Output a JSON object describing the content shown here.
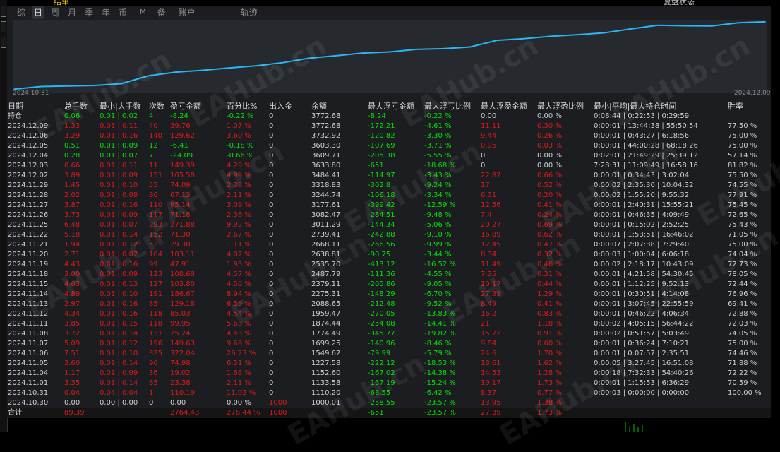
{
  "top_strip": {
    "left_text": "结单",
    "right_text": "复盘状态"
  },
  "tabs": [
    "综",
    "日",
    "周",
    "月",
    "季",
    "年",
    "币",
    "M",
    "备",
    "账户",
    "轨迹"
  ],
  "active_tab": "日",
  "chart_data": {
    "type": "line",
    "x_start_label": "2024.10.31",
    "x_end_label": "2024.12.09",
    "series_color": "#29b6f6",
    "ylim": [
      950,
      3800
    ],
    "x": [
      "2024.10.30",
      "2024.10.31",
      "2024.11.01",
      "2024.11.04",
      "2024.11.05",
      "2024.11.06",
      "2024.11.07",
      "2024.11.08",
      "2024.11.11",
      "2024.11.12",
      "2024.11.13",
      "2024.11.14",
      "2024.11.15",
      "2024.11.18",
      "2024.11.19",
      "2024.11.20",
      "2024.11.21",
      "2024.11.22",
      "2024.11.25",
      "2024.11.26",
      "2024.11.27",
      "2024.11.28",
      "2024.11.29",
      "2024.12.02",
      "2024.12.03",
      "2024.12.04",
      "2024.12.05",
      "2024.12.06",
      "2024.12.09"
    ],
    "values": [
      1000.01,
      1110.2,
      1133.58,
      1152.6,
      1227.58,
      1549.62,
      1699.25,
      1774.49,
      1874.44,
      1959.47,
      2088.65,
      2275.31,
      2379.11,
      2487.79,
      2535.7,
      2638.81,
      2668.11,
      2739.41,
      3011.29,
      3082.47,
      3177.61,
      3244.74,
      3318.83,
      3484.41,
      3633.8,
      3609.71,
      3603.3,
      3732.92,
      3772.68
    ]
  },
  "colors": {
    "positive": "#00e000",
    "negative": "#e01818",
    "neutral": "#d0d0d0",
    "line": "#29b6f6"
  },
  "headers": [
    "日期",
    "总手数",
    "最小|大手数",
    "次数",
    "盈亏金额",
    "百分比%",
    "出入金",
    "余额",
    "最大浮亏金额",
    "最大浮亏比例",
    "最大浮盈金额",
    "最大浮盈比例",
    "最小|平均|最大持仓时间",
    "胜率"
  ],
  "rows": [
    {
      "c": [
        "持仓",
        "0.06",
        "0.01 | 0.02",
        "4",
        "-8.24",
        "-0.22 %",
        "0",
        "3772.68",
        "-8.24",
        "-0.22 %",
        "0.00",
        "0.00 %",
        "0:08:44 | 0:22:53 | 0:29:59",
        ""
      ],
      "k": [
        "w",
        "g",
        "g",
        "g",
        "g",
        "g",
        "w",
        "w",
        "g",
        "g",
        "w",
        "w",
        "w",
        "w"
      ]
    },
    {
      "c": [
        "2024.12.09",
        "1.33",
        "0.01 | 0.11",
        "40",
        "39.76",
        "1.07 %",
        "0",
        "3772.68",
        "-172.21",
        "-4.61 %",
        "11.11",
        "0.30 %",
        "0:00:01 | 13:44:38 | 55:50:54",
        "77.50 %"
      ],
      "k": [
        "w",
        "r",
        "r",
        "r",
        "r",
        "r",
        "w",
        "w",
        "g",
        "g",
        "r",
        "r",
        "w",
        "w"
      ]
    },
    {
      "c": [
        "2024.12.06",
        "3.29",
        "0.01 | 0.16",
        "140",
        "129.62",
        "3.60 %",
        "0",
        "3732.92",
        "-120.82",
        "-3.30 %",
        "9.44",
        "0.26 %",
        "0:00:01 | 0:43:27 | 6:18:56",
        "75.00 %"
      ],
      "k": [
        "w",
        "r",
        "r",
        "r",
        "r",
        "r",
        "w",
        "w",
        "g",
        "g",
        "r",
        "r",
        "w",
        "w"
      ]
    },
    {
      "c": [
        "2024.12.05",
        "0.51",
        "0.01 | 0.09",
        "12",
        "-6.41",
        "-0.18 %",
        "0",
        "3603.30",
        "-107.69",
        "-3.71 %",
        "0.96",
        "0.03 %",
        "0:00:01 | 44:00:28 | 68:18:26",
        "75.00 %"
      ],
      "k": [
        "w",
        "g",
        "g",
        "g",
        "g",
        "g",
        "w",
        "w",
        "g",
        "g",
        "r",
        "r",
        "w",
        "w"
      ]
    },
    {
      "c": [
        "2024.12.04",
        "0.28",
        "0.01 | 0.07",
        "7",
        "-24.09",
        "-0.66 %",
        "0",
        "3609.71",
        "-205.38",
        "-5.55 %",
        "0",
        "0.00 %",
        "0:02:01 | 21:49:29 | 25:39:12",
        "57.14 %"
      ],
      "k": [
        "w",
        "g",
        "g",
        "g",
        "g",
        "g",
        "w",
        "w",
        "g",
        "g",
        "w",
        "w",
        "w",
        "w"
      ]
    },
    {
      "c": [
        "2024.12.03",
        "0.66",
        "0.01 | 0.11",
        "11",
        "149.39",
        "4.29 %",
        "0",
        "3633.80",
        "-651",
        "-18.68 %",
        "0",
        "0.00 %",
        "7:28:31 | 11:09:49 | 16:58:16",
        "81.82 %"
      ],
      "k": [
        "w",
        "r",
        "r",
        "r",
        "r",
        "r",
        "w",
        "w",
        "g",
        "g",
        "w",
        "w",
        "w",
        "w"
      ]
    },
    {
      "c": [
        "2024.12.02",
        "3.89",
        "0.01 | 0.09",
        "151",
        "165.58",
        "4.99 %",
        "0",
        "3484.41",
        "-114.97",
        "-3.43 %",
        "22.87",
        "0.66 %",
        "0:00:01 | 0:34:43 | 3:02:04",
        "75.50 %"
      ],
      "k": [
        "w",
        "r",
        "r",
        "r",
        "r",
        "r",
        "w",
        "w",
        "g",
        "g",
        "r",
        "r",
        "w",
        "w"
      ]
    },
    {
      "c": [
        "2024.11.29",
        "1.45",
        "0.01 | 0.10",
        "55",
        "74.09",
        "2.28 %",
        "0",
        "3318.83",
        "-302.8",
        "-9.24 %",
        "17",
        "0.52 %",
        "0:00:02 | 2:35:30 | 10:04:32",
        "74.55 %"
      ],
      "k": [
        "w",
        "r",
        "r",
        "r",
        "r",
        "r",
        "w",
        "w",
        "g",
        "g",
        "r",
        "r",
        "w",
        "w"
      ]
    },
    {
      "c": [
        "2024.11.28",
        "2.02",
        "0.01 | 0.08",
        "86",
        "67.13",
        "2.11 %",
        "0",
        "3244.74",
        "-106.18",
        "-3.34 %",
        "6.31",
        "0.20 %",
        "0:00:02 | 1:55:20 | 9:55:32",
        "77.91 %"
      ],
      "k": [
        "w",
        "r",
        "r",
        "r",
        "r",
        "r",
        "w",
        "w",
        "g",
        "g",
        "r",
        "r",
        "w",
        "w"
      ]
    },
    {
      "c": [
        "2024.11.27",
        "3.87",
        "0.01 | 0.16",
        "110",
        "95.14",
        "3.09 %",
        "0",
        "3177.61",
        "-399.42",
        "-12.59 %",
        "12.56",
        "0.41 %",
        "0:00:01 | 2:40:31 | 15:55:21",
        "75.45 %"
      ],
      "k": [
        "w",
        "r",
        "r",
        "r",
        "r",
        "r",
        "w",
        "w",
        "g",
        "g",
        "r",
        "r",
        "w",
        "w"
      ]
    },
    {
      "c": [
        "2024.11.26",
        "3.73",
        "0.01 | 0.09",
        "117",
        "71.18",
        "2.36 %",
        "0",
        "3082.47",
        "-284.51",
        "-9.48 %",
        "7.4",
        "0.24 %",
        "0:00:01 | 0:46:35 | 4:09:49",
        "72.65 %"
      ],
      "k": [
        "w",
        "r",
        "r",
        "r",
        "r",
        "r",
        "w",
        "w",
        "g",
        "g",
        "r",
        "r",
        "w",
        "w"
      ]
    },
    {
      "c": [
        "2024.11.25",
        "6.48",
        "0.01 | 0.07",
        "293",
        "271.88",
        "9.92 %",
        "0",
        "3011.29",
        "-144.34",
        "-5.06 %",
        "20.27",
        "0.69 %",
        "0:00:01 | 0:15:02 | 2:52:25",
        "75.43 %"
      ],
      "k": [
        "w",
        "r",
        "r",
        "r",
        "r",
        "r",
        "w",
        "w",
        "g",
        "g",
        "r",
        "r",
        "w",
        "w"
      ]
    },
    {
      "c": [
        "2024.11.22",
        "5.18",
        "0.01 | 0.14",
        "152",
        "71.30",
        "2.67 %",
        "0",
        "2739.41",
        "-242.88",
        "-9.10 %",
        "16.89",
        "0.62 %",
        "0:00:01 | 1:53:51 | 16:46:02",
        "71.05 %"
      ],
      "k": [
        "w",
        "r",
        "r",
        "r",
        "r",
        "r",
        "w",
        "w",
        "g",
        "g",
        "r",
        "r",
        "w",
        "w"
      ]
    },
    {
      "c": [
        "2024.11.21",
        "1.94",
        "0.01 | 0.12",
        "52",
        "29.30",
        "1.11 %",
        "0",
        "2668.11",
        "-266.56",
        "-9.99 %",
        "12.45",
        "0.47 %",
        "0:00:07 | 2:07:38 | 7:29:40",
        "75.00 %"
      ],
      "k": [
        "w",
        "r",
        "r",
        "r",
        "r",
        "r",
        "w",
        "w",
        "g",
        "g",
        "r",
        "r",
        "w",
        "w"
      ]
    },
    {
      "c": [
        "2024.11.20",
        "2.71",
        "0.01 | 0.07",
        "104",
        "103.11",
        "4.07 %",
        "0",
        "2638.81",
        "-90.75",
        "-3.44 %",
        "8.34",
        "0.32 %",
        "0:00:03 | 1:00:04 | 6:06:18",
        "74.04 %"
      ],
      "k": [
        "w",
        "r",
        "r",
        "r",
        "r",
        "r",
        "w",
        "w",
        "g",
        "g",
        "r",
        "r",
        "w",
        "w"
      ]
    },
    {
      "c": [
        "2024.11.19",
        "4.43",
        "0.01 | 0.16",
        "99",
        "47.91",
        "1.93 %",
        "0",
        "2535.70",
        "-413.12",
        "-16.52 %",
        "11.49",
        "0.46 %",
        "0:00:02 | 2:18:17 | 10:43:09",
        "72.73 %"
      ],
      "k": [
        "w",
        "r",
        "r",
        "r",
        "r",
        "r",
        "w",
        "w",
        "g",
        "g",
        "r",
        "r",
        "w",
        "w"
      ]
    },
    {
      "c": [
        "2024.11.18",
        "3.00",
        "0.01 | 0.09",
        "123",
        "108.68",
        "4.57 %",
        "0",
        "2487.79",
        "-111.36",
        "-4.55 %",
        "7.35",
        "0.31 %",
        "0:00:01 | 4:21:58 | 54:30:45",
        "78.05 %"
      ],
      "k": [
        "w",
        "r",
        "r",
        "r",
        "r",
        "r",
        "w",
        "w",
        "g",
        "g",
        "r",
        "r",
        "w",
        "w"
      ]
    },
    {
      "c": [
        "2024.11.15",
        "4.03",
        "0.01 | 0.13",
        "127",
        "103.80",
        "4.56 %",
        "0",
        "2379.11",
        "-205.86",
        "-9.05 %",
        "10.17",
        "0.44 %",
        "0:00:01 | 1:12:25 | 9:52:13",
        "72.44 %"
      ],
      "k": [
        "w",
        "r",
        "r",
        "r",
        "r",
        "r",
        "w",
        "w",
        "g",
        "g",
        "r",
        "r",
        "w",
        "w"
      ]
    },
    {
      "c": [
        "2024.11.14",
        "4.89",
        "0.01 | 0.10",
        "191",
        "186.67",
        "8.94 %",
        "0",
        "2275.31",
        "-148.29",
        "-6.70 %",
        "27.39",
        "1.29 %",
        "0:00:01 | 0:30:51 | 4:14:08",
        "76.96 %"
      ],
      "k": [
        "w",
        "r",
        "r",
        "r",
        "r",
        "r",
        "w",
        "w",
        "g",
        "g",
        "r",
        "r",
        "w",
        "w"
      ]
    },
    {
      "c": [
        "2024.11.13",
        "2.97",
        "0.01 | 0.16",
        "85",
        "129.18",
        "6.59 %",
        "0",
        "2088.65",
        "-212.48",
        "-9.52 %",
        "8.49",
        "0.41 %",
        "0:00:01 | 3:07:45 | 22:55:59",
        "69.41 %"
      ],
      "k": [
        "w",
        "r",
        "r",
        "r",
        "r",
        "r",
        "w",
        "w",
        "g",
        "g",
        "r",
        "r",
        "w",
        "w"
      ]
    },
    {
      "c": [
        "2024.11.12",
        "4.34",
        "0.01 | 0.16",
        "118",
        "85.03",
        "4.54 %",
        "0",
        "1959.47",
        "-270.05",
        "-13.83 %",
        "16.2",
        "0.83 %",
        "0:00:01 | 0:46:22 | 4:06:34",
        "72.88 %"
      ],
      "k": [
        "w",
        "r",
        "r",
        "r",
        "r",
        "r",
        "w",
        "w",
        "g",
        "g",
        "r",
        "r",
        "w",
        "w"
      ]
    },
    {
      "c": [
        "2024.11.11",
        "3.85",
        "0.01 | 0.15",
        "118",
        "99.95",
        "5.63 %",
        "0",
        "1874.44",
        "-254.08",
        "-14.41 %",
        "21",
        "1.18 %",
        "0:00:02 | 4:05:15 | 56:44:22",
        "72.03 %"
      ],
      "k": [
        "w",
        "r",
        "r",
        "r",
        "r",
        "r",
        "w",
        "w",
        "g",
        "g",
        "r",
        "r",
        "w",
        "w"
      ]
    },
    {
      "c": [
        "2024.11.08",
        "3.72",
        "0.01 | 0.14",
        "131",
        "75.24",
        "4.43 %",
        "0",
        "1774.49",
        "-345.77",
        "-19.82 %",
        "15.72",
        "0.91 %",
        "0:00:02 | 0:51:57 | 5:03:49",
        "74.05 %"
      ],
      "k": [
        "w",
        "r",
        "r",
        "r",
        "r",
        "r",
        "w",
        "w",
        "g",
        "g",
        "r",
        "r",
        "w",
        "w"
      ]
    },
    {
      "c": [
        "2024.11.07",
        "5.09",
        "0.01 | 0.12",
        "196",
        "149.63",
        "9.66 %",
        "0",
        "1699.25",
        "-140.96",
        "-8.46 %",
        "9.84",
        "0.60 %",
        "0:00:01 | 0:36:24 | 7:10:21",
        "75.00 %"
      ],
      "k": [
        "w",
        "r",
        "r",
        "r",
        "r",
        "r",
        "w",
        "w",
        "g",
        "g",
        "r",
        "r",
        "w",
        "w"
      ]
    },
    {
      "c": [
        "2024.11.06",
        "7.51",
        "0.01 | 0.10",
        "325",
        "322.04",
        "26.23 %",
        "0",
        "1549.62",
        "-79.99",
        "-5.79 %",
        "24.6",
        "1.70 %",
        "0:00:01 | 0:07:57 | 2:35:51",
        "74.46 %"
      ],
      "k": [
        "w",
        "r",
        "r",
        "r",
        "r",
        "r",
        "w",
        "w",
        "g",
        "g",
        "r",
        "r",
        "w",
        "w"
      ]
    },
    {
      "c": [
        "2024.11.05",
        "3.60",
        "0.01 | 0.14",
        "96",
        "74.98",
        "6.51 %",
        "0",
        "1227.58",
        "-222.12",
        "-18.53 %",
        "18.61",
        "1.62 %",
        "0:00:05 | 3:27:45 | 16:51:08",
        "71.88 %"
      ],
      "k": [
        "w",
        "r",
        "r",
        "r",
        "r",
        "r",
        "w",
        "w",
        "g",
        "g",
        "r",
        "r",
        "w",
        "w"
      ]
    },
    {
      "c": [
        "2024.11.04",
        "1.17",
        "0.01 | 0.09",
        "36",
        "19.02",
        "1.68 %",
        "0",
        "1152.60",
        "-167.02",
        "-14.38 %",
        "14.53",
        "1.28 %",
        "0:00:18 | 7:32:33 | 54:40:26",
        "72.22 %"
      ],
      "k": [
        "w",
        "r",
        "r",
        "r",
        "r",
        "r",
        "w",
        "w",
        "g",
        "g",
        "r",
        "r",
        "w",
        "w"
      ]
    },
    {
      "c": [
        "2024.11.01",
        "3.35",
        "0.01 | 0.14",
        "85",
        "23.38",
        "2.11 %",
        "0",
        "1133.58",
        "-167.19",
        "-15.24 %",
        "19.17",
        "1.73 %",
        "0:00:01 | 1:15:53 | 6:36:29",
        "70.59 %"
      ],
      "k": [
        "w",
        "r",
        "r",
        "r",
        "r",
        "r",
        "w",
        "w",
        "g",
        "g",
        "r",
        "r",
        "w",
        "w"
      ]
    },
    {
      "c": [
        "2024.10.31",
        "0.04",
        "0.04 | 0.04",
        "1",
        "110.19",
        "11.02 %",
        "0",
        "1110.20",
        "-68.55",
        "-6.42 %",
        "8.37",
        "0.77 %",
        "0:00:03 | 0:00:00 | 0:00:00",
        "100.00 %"
      ],
      "k": [
        "w",
        "r",
        "r",
        "r",
        "r",
        "r",
        "w",
        "w",
        "g",
        "g",
        "r",
        "r",
        "w",
        "w"
      ]
    },
    {
      "c": [
        "2024.10.30",
        "0.00",
        "0.00 | 0.00",
        "0",
        "0.00",
        "0.00 %",
        "1000",
        "1000.01",
        "-258.55",
        "-23.57 %",
        "13.95",
        "1.38 %",
        "",
        ""
      ],
      "k": [
        "w",
        "w",
        "w",
        "w",
        "w",
        "w",
        "r",
        "w",
        "g",
        "g",
        "r",
        "r",
        "w",
        "w"
      ]
    }
  ],
  "total": {
    "c": [
      "合计",
      "89.39",
      "",
      "",
      "2764.43",
      "276.44 %",
      "1000",
      "",
      "-651",
      "-23.57 %",
      "27.39",
      "1.73 %",
      "",
      ""
    ],
    "k": [
      "w",
      "r",
      "w",
      "w",
      "r",
      "r",
      "r",
      "w",
      "g",
      "g",
      "r",
      "r",
      "w",
      "w"
    ]
  },
  "watermark": "EAHub.cn"
}
